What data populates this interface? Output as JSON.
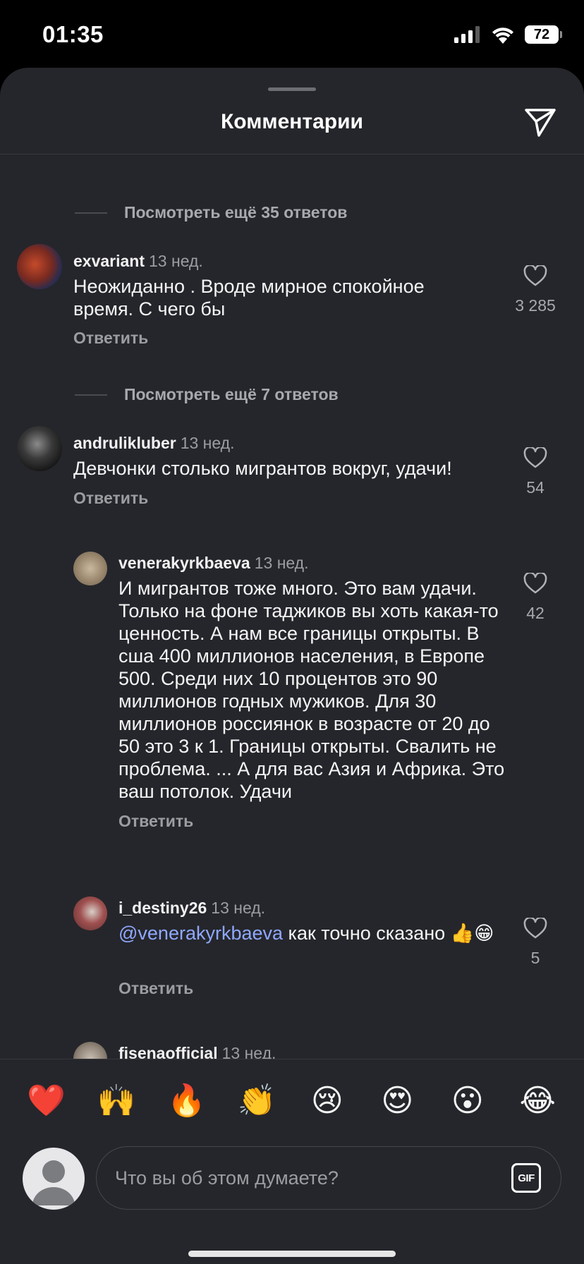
{
  "status": {
    "time": "01:35",
    "battery": "72"
  },
  "header": {
    "title": "Комментарии"
  },
  "view_more_1": "Посмотреть ещё 35 ответов",
  "view_more_2": "Посмотреть ещё 7 ответов",
  "comments": [
    {
      "user": "exvariant",
      "time": "13 нед.",
      "text": "Неожиданно . Вроде мирное спокойное время. С чего бы",
      "reply": "Ответить",
      "likes": "3 285"
    },
    {
      "user": "andrulikluber",
      "time": "13 нед.",
      "text": "Девчонки столько мигрантов вокруг, удачи!",
      "reply": "Ответить",
      "likes": "54"
    },
    {
      "user": "venerakyrkbaeva",
      "time": "13 нед.",
      "text": "И мигрантов тоже много. Это вам удачи. Только на фоне таджиков вы хоть какая-то ценность. А нам все границы открыты. В сша 400 миллионов населения, в Европе 500. Среди них 10 процентов это 90 миллионов годных мужиков. Для 30 миллионов россиянок  в возрасте от 20 до 50 это 3 к 1. Границы открыты. Свалить не проблема. ... А для вас Азия и Африка. Это ваш потолок. Удачи",
      "reply": "Ответить",
      "likes": "42"
    },
    {
      "user": "i_destiny26",
      "time": "13 нед.",
      "mention": "@venerakyrkbaeva",
      "text": " как точно сказано 👍😁",
      "reply": "Ответить",
      "likes": "5"
    },
    {
      "user": "fisenaofficial",
      "time": "13 нед."
    }
  ],
  "emojis": [
    "❤️",
    "🙌",
    "🔥",
    "👏",
    "😢",
    "😍",
    "😮",
    "😂"
  ],
  "composer": {
    "placeholder": "Что вы об этом думаете?",
    "gif_label": "GIF"
  }
}
